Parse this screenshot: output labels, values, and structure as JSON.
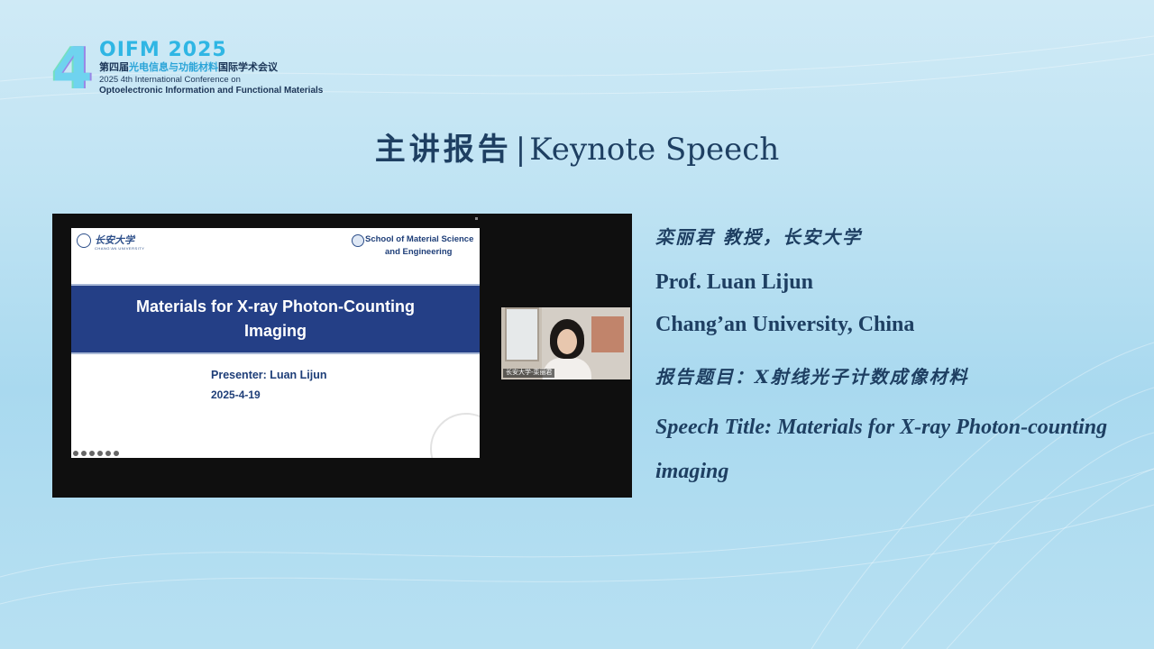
{
  "conference": {
    "acronym": "OIFM 2025",
    "edition_mark": "4",
    "cn_name_prefix": "第四届",
    "cn_name_highlight": "光电信息与功能材料",
    "cn_name_suffix": "国际学术会议",
    "en_line1": "2025 4th International Conference on",
    "en_line2": "Optoelectronic Information and Functional Materials"
  },
  "title": {
    "cn": "主讲报告",
    "separator": "|",
    "en": "Keynote Speech"
  },
  "video": {
    "slide": {
      "university_logo_text": "长安大学",
      "university_en": "CHANG'AN UNIVERSITY",
      "school_line1": "School of Material Science",
      "school_line2": "and Engineering",
      "title_line1": "Materials for X-ray Photon-Counting",
      "title_line2": "Imaging",
      "presenter": "Presenter:  Luan Lijun",
      "date": "2025-4-19"
    },
    "webcam": {
      "participant_tag": "长安大学-栾丽君"
    }
  },
  "speaker": {
    "cn_name_affiliation": "栾丽君 教授，长安大学",
    "en_name": "Prof. Luan Lijun",
    "en_affiliation": "Chang’an University, China",
    "cn_talk_title": "报告题目：X射线光子计数成像材料",
    "en_talk_title": "Speech Title: Materials for X-ray Photon-counting imaging"
  },
  "colors": {
    "title_text": "#1e3f62",
    "slide_banner": "#243f86",
    "accent_cyan": "#2fb6e4"
  }
}
